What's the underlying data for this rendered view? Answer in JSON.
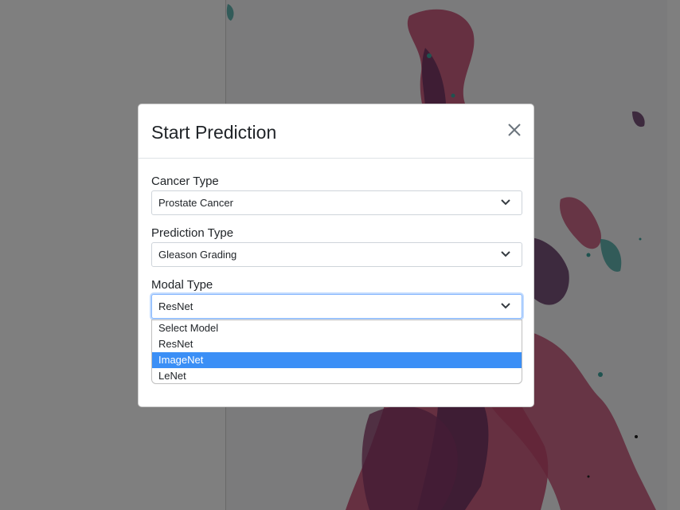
{
  "modal": {
    "title": "Start Prediction",
    "close_icon": "close-icon"
  },
  "form": {
    "cancer_type": {
      "label": "Cancer Type",
      "value": "Prostate Cancer"
    },
    "prediction_type": {
      "label": "Prediction Type",
      "value": "Gleason Grading"
    },
    "modal_type": {
      "label": "Modal Type",
      "value": "ResNet",
      "options": [
        "Select Model",
        "ResNet",
        "ImageNet",
        "LeNet"
      ],
      "highlighted_option": "ImageNet"
    }
  },
  "icons": {
    "dropdown": "chevron-down-icon",
    "close": "close-icon"
  },
  "colors": {
    "highlight": "#3b8ff6",
    "focus_border": "#86b7fe",
    "tissue_pink": "#c4476e",
    "tissue_purple": "#5a2a5e",
    "tissue_teal": "#3fa6a0"
  }
}
